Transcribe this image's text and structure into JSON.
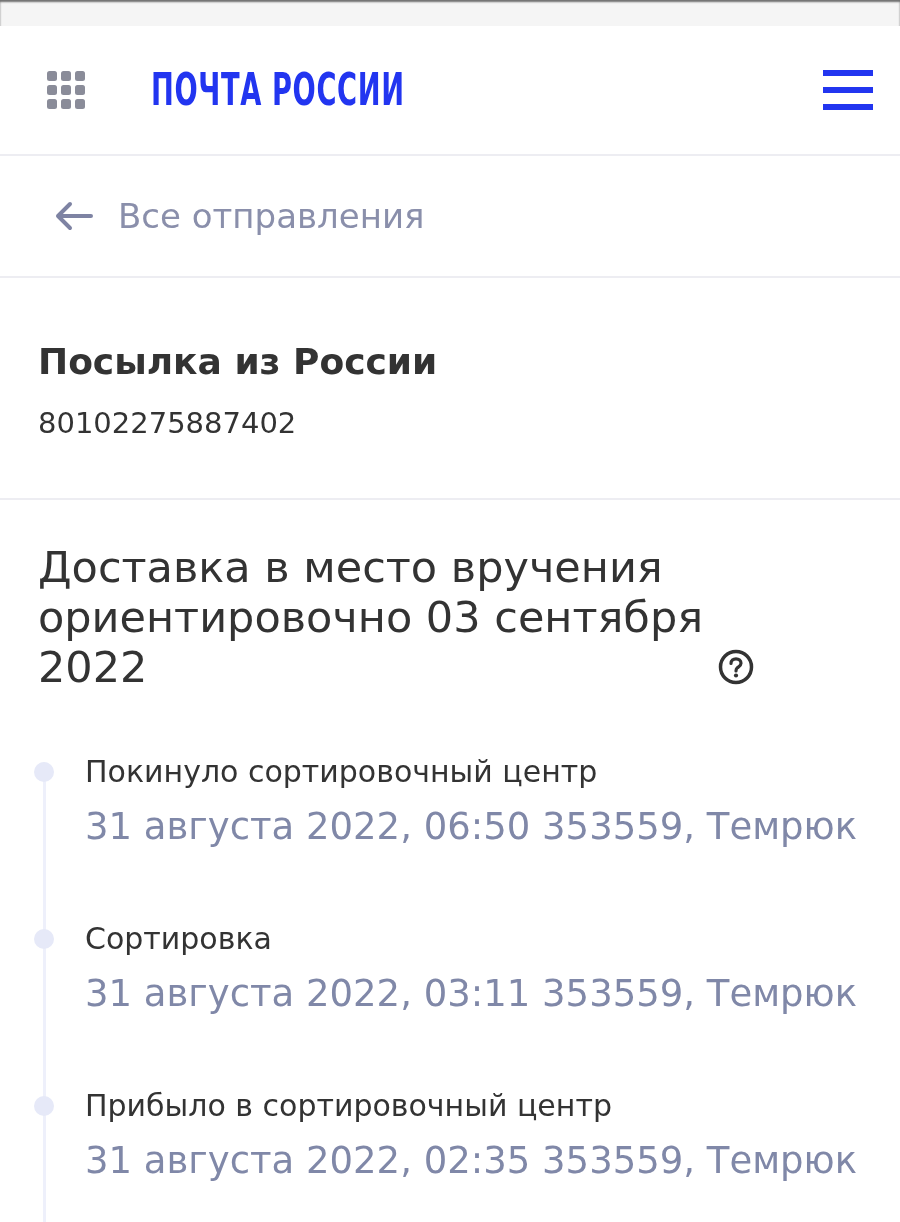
{
  "header": {
    "logo": "ПОЧТА РОССИИ"
  },
  "back_link": {
    "label": "Все отправления"
  },
  "shipment": {
    "title": "Посылка из России",
    "tracking_number": "80102275887402"
  },
  "delivery": {
    "estimate": "Доставка в место вручения ориентировочно 03 сентября 2022"
  },
  "timeline": [
    {
      "status": "Покинуло сортировочный центр",
      "date": "31 августа 2022, 06:50",
      "place": "353559, Темрюк"
    },
    {
      "status": "Сортировка",
      "date": "31 августа 2022, 03:11",
      "place": "353559, Темрюк"
    },
    {
      "status": "Прибыло в сортировочный центр",
      "date": "31 августа 2022, 02:35",
      "place": "353559, Темрюк"
    }
  ]
}
